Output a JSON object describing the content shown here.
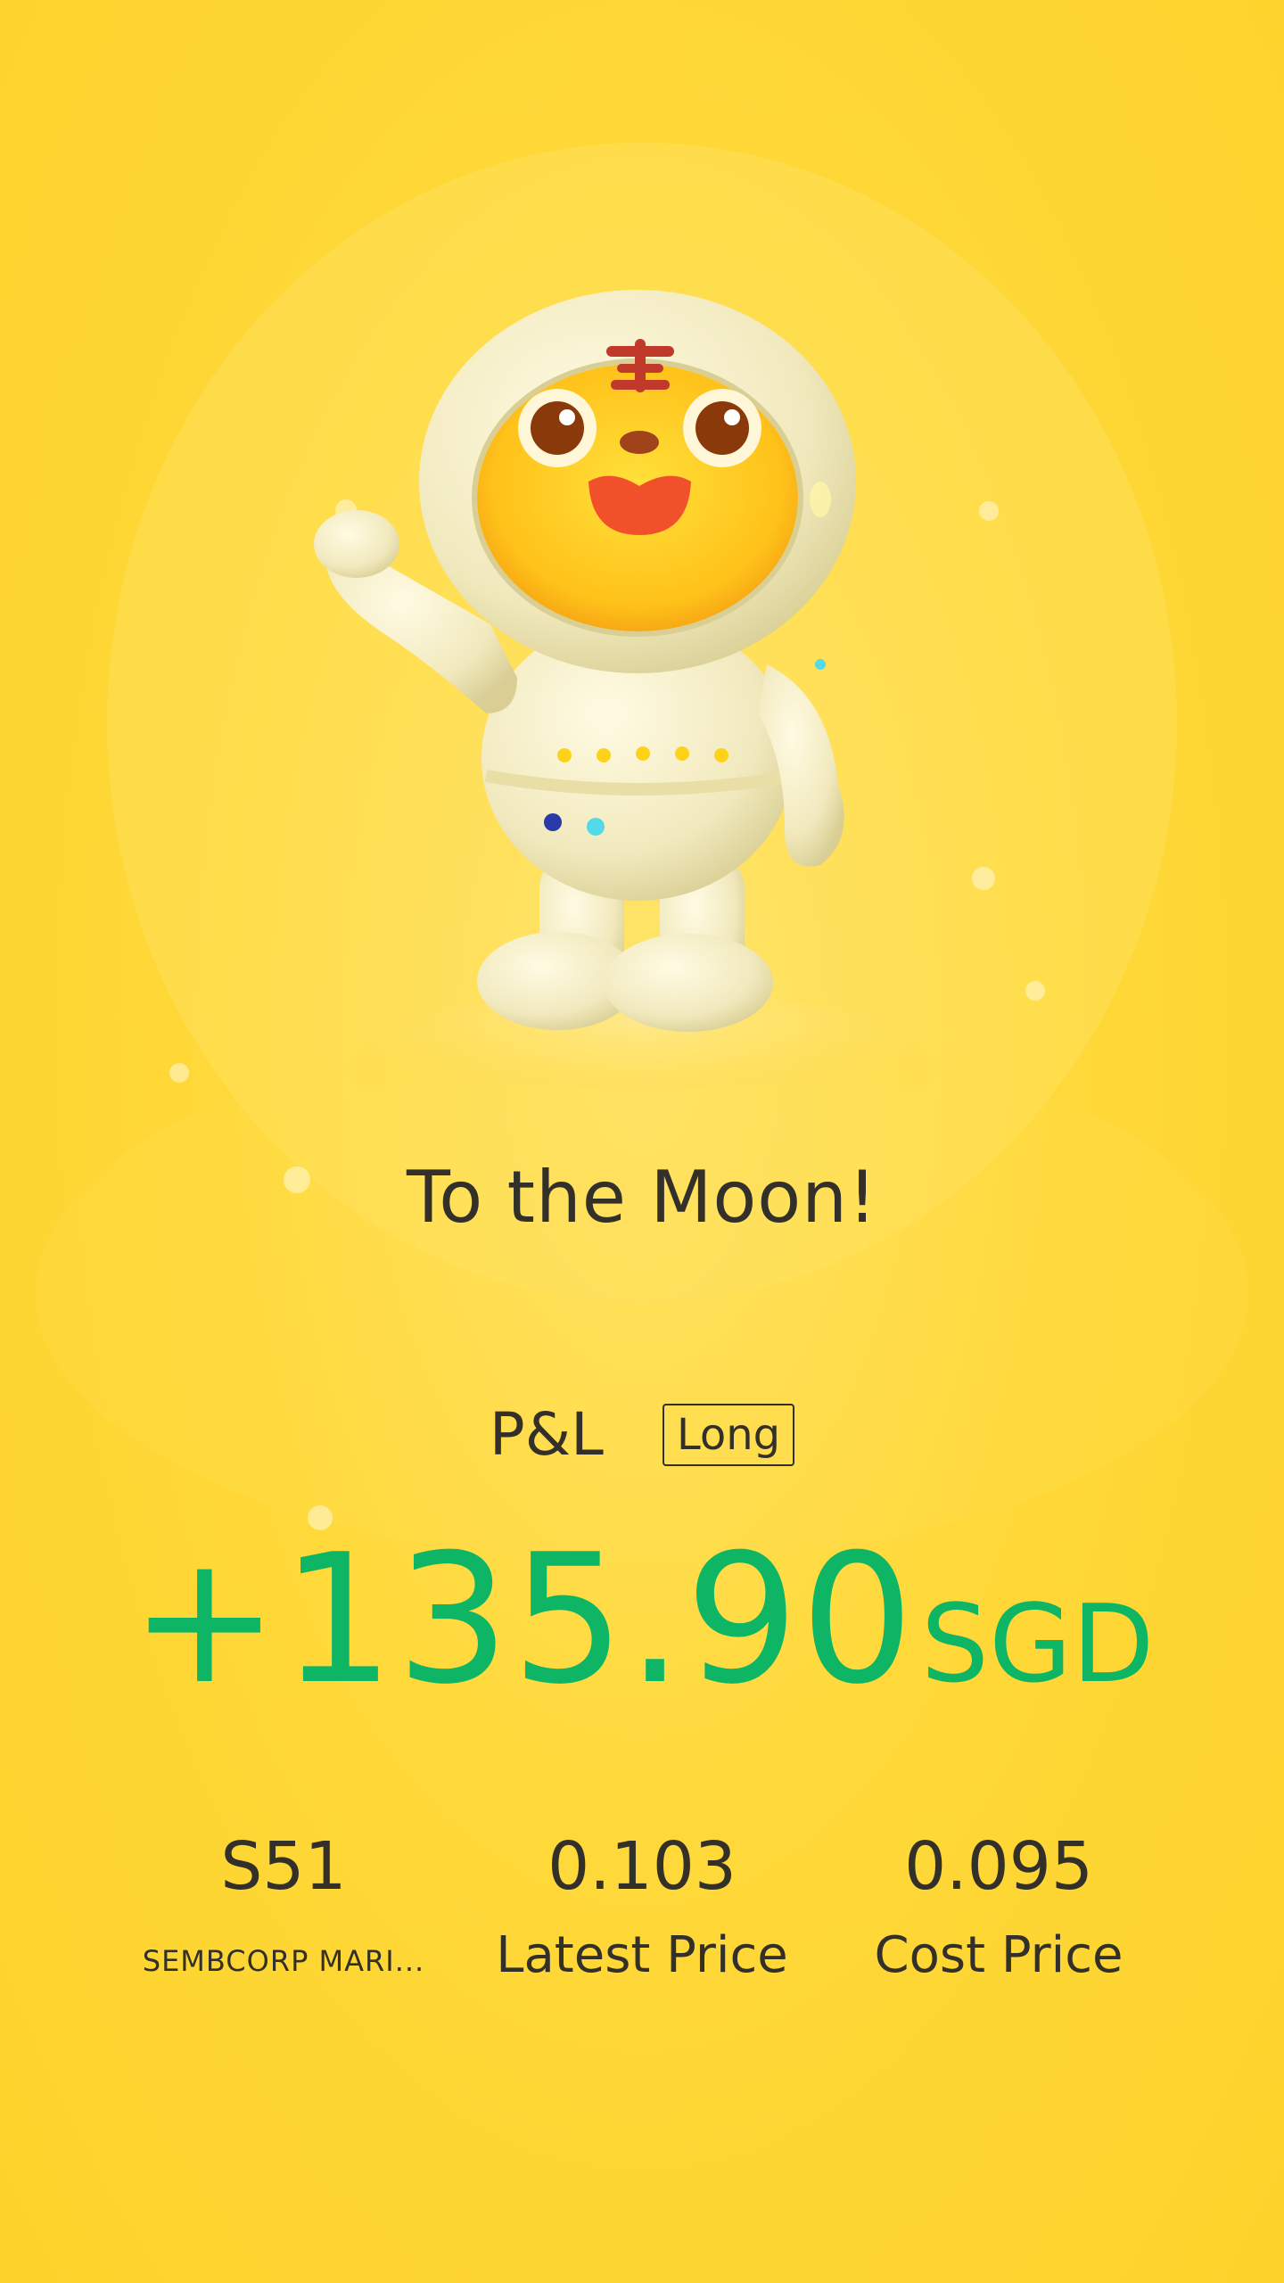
{
  "headline": "To the Moon!",
  "pnl": {
    "label": "P&L",
    "position": "Long",
    "amount": "+135.90",
    "currency": "SGD",
    "color": "#0db564"
  },
  "stats": [
    {
      "value": "S51",
      "label": "SEMBCORP MARI..."
    },
    {
      "value": "0.103",
      "label": "Latest Price"
    },
    {
      "value": "0.095",
      "label": "Cost Price"
    }
  ],
  "background_color": "#ffd93a",
  "mascot": "tiger-astronaut-waving"
}
